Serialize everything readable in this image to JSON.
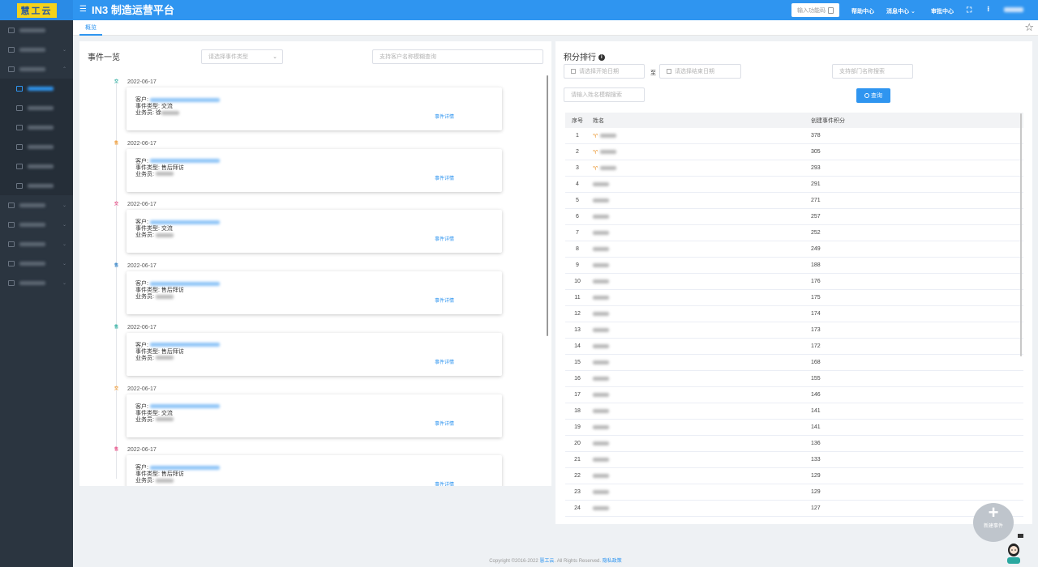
{
  "brand": {
    "logo_text": "慧工云"
  },
  "header": {
    "title": "IN3 制造运营平台",
    "quick_placeholder": "输入功能码",
    "help": "帮助中心",
    "messages": "消息中心",
    "approval": "审批中心"
  },
  "tabs": [
    {
      "label": "概览"
    }
  ],
  "events": {
    "title": "事件一览",
    "type_placeholder": "请选择事件类型",
    "search_placeholder": "支持客户名称模糊查询",
    "customer_label": "客户:",
    "type_label": "事件类型:",
    "staff_label": "业务员:",
    "detail_link": "事件详情",
    "items": [
      {
        "date": "2022-06-17",
        "type": "交流",
        "staff": "徐",
        "dot_color": "#3bb3a6",
        "dot_glyph": "交"
      },
      {
        "date": "2022-06-17",
        "type": "售后拜访",
        "staff": "",
        "dot_color": "#f0a040",
        "dot_glyph": "售"
      },
      {
        "date": "2022-06-17",
        "type": "交流",
        "staff": "",
        "dot_color": "#e8578c",
        "dot_glyph": "交"
      },
      {
        "date": "2022-06-17",
        "type": "售后拜访",
        "staff": "",
        "dot_color": "#3a86c8",
        "dot_glyph": "售"
      },
      {
        "date": "2022-06-17",
        "type": "售后拜访",
        "staff": "",
        "dot_color": "#3bb3a6",
        "dot_glyph": "售"
      },
      {
        "date": "2022-06-17",
        "type": "交流",
        "staff": "",
        "dot_color": "#f0a040",
        "dot_glyph": "交"
      },
      {
        "date": "2022-06-17",
        "type": "售后拜访",
        "staff": "",
        "dot_color": "#e8578c",
        "dot_glyph": "售"
      }
    ]
  },
  "ranking": {
    "title": "积分排行",
    "start_placeholder": "请选择开始日期",
    "to_label": "至",
    "end_placeholder": "请选择结束日期",
    "dept_placeholder": "支持部门名称搜索",
    "name_placeholder": "请输入姓名模糊搜索",
    "query_label": "查询",
    "columns": [
      "序号",
      "姓名",
      "创建事件积分"
    ],
    "rows": [
      {
        "rank": "1",
        "score": "378",
        "medal": true
      },
      {
        "rank": "2",
        "score": "305",
        "medal": true
      },
      {
        "rank": "3",
        "score": "293",
        "medal": true
      },
      {
        "rank": "4",
        "score": "291",
        "medal": false
      },
      {
        "rank": "5",
        "score": "271",
        "medal": false
      },
      {
        "rank": "6",
        "score": "257",
        "medal": false
      },
      {
        "rank": "7",
        "score": "252",
        "medal": false
      },
      {
        "rank": "8",
        "score": "249",
        "medal": false
      },
      {
        "rank": "9",
        "score": "188",
        "medal": false
      },
      {
        "rank": "10",
        "score": "176",
        "medal": false
      },
      {
        "rank": "11",
        "score": "175",
        "medal": false
      },
      {
        "rank": "12",
        "score": "174",
        "medal": false
      },
      {
        "rank": "13",
        "score": "173",
        "medal": false
      },
      {
        "rank": "14",
        "score": "172",
        "medal": false
      },
      {
        "rank": "15",
        "score": "168",
        "medal": false
      },
      {
        "rank": "16",
        "score": "155",
        "medal": false
      },
      {
        "rank": "17",
        "score": "146",
        "medal": false
      },
      {
        "rank": "18",
        "score": "141",
        "medal": false
      },
      {
        "rank": "19",
        "score": "141",
        "medal": false
      },
      {
        "rank": "20",
        "score": "136",
        "medal": false
      },
      {
        "rank": "21",
        "score": "133",
        "medal": false
      },
      {
        "rank": "22",
        "score": "129",
        "medal": false
      },
      {
        "rank": "23",
        "score": "129",
        "medal": false
      },
      {
        "rank": "24",
        "score": "127",
        "medal": false
      }
    ]
  },
  "fab": {
    "label": "新建事件"
  },
  "footer": {
    "copyright": "Copyright ©2016-2022",
    "brand": "慧工云",
    "rights": ". All Rights Reserved.",
    "privacy": "隐私政策"
  },
  "icons": {
    "menu": "hamburger-icon",
    "star": "star-icon",
    "calendar": "calendar-icon",
    "search": "search-icon",
    "info": "info-icon"
  }
}
